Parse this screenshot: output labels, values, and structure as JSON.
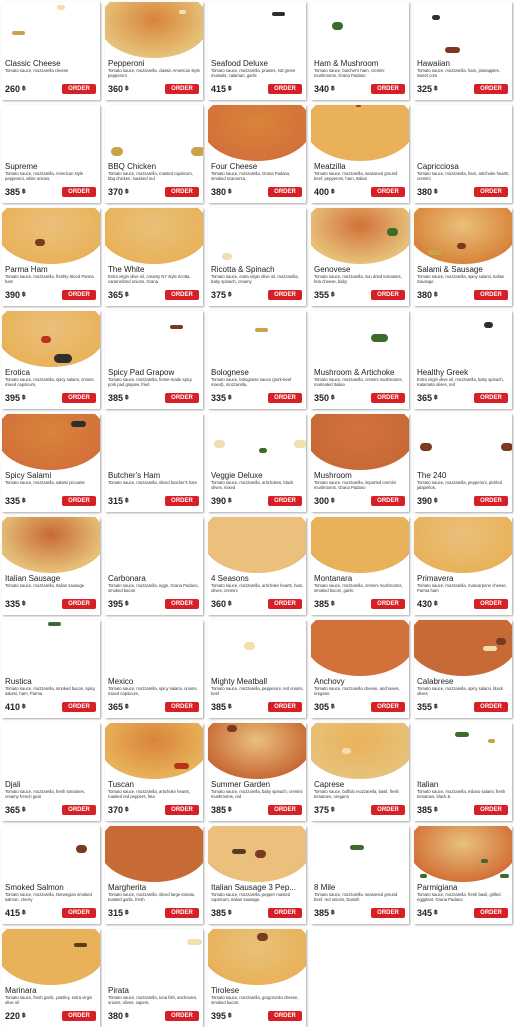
{
  "currency_symbol": "฿",
  "order_label": "ORDER",
  "colors": {
    "order_button": "#d71f26",
    "crust": "#d98c3a"
  },
  "menu": [
    {
      "name": "Classic Cheese",
      "desc": "Tomato sauce, mozzarella cheese",
      "price": "260",
      "image": "pizza-cheese"
    },
    {
      "name": "Pepperoni",
      "desc": "Tomato sauce, mozzarella, classic American style pepperoni",
      "price": "360",
      "image": "pizza-pepperoni"
    },
    {
      "name": "Seafood Deluxe",
      "desc": "Tomato sauce, mozzarella, prawns, NZ green mussels, calamari, garlic",
      "price": "415",
      "image": "pizza-seafood"
    },
    {
      "name": "Ham & Mushroom",
      "desc": "Tomato sauce, butcher's ham, cremini mushrooms, Grana Padano",
      "price": "340",
      "image": "pizza-ham-mushroom"
    },
    {
      "name": "Hawaiian",
      "desc": "Tomato sauce, mozzarella, ham, pineapples, sweet corn",
      "price": "325",
      "image": "pizza-hawaiian"
    },
    {
      "name": "Supreme",
      "desc": "Tomato sauce, mozzarella, American style pepperoni, white onions,",
      "price": "385",
      "image": "pizza-supreme"
    },
    {
      "name": "BBQ Chicken",
      "desc": "Tomato sauce, mozzarella, roasted capsicum, bbq chicken, sautéed red",
      "price": "370",
      "image": "pizza-bbq"
    },
    {
      "name": "Four Cheese",
      "desc": "Tomato sauce, mozzarella, Grana Padano, smoked scamorza,",
      "price": "380",
      "image": "pizza-four-cheese"
    },
    {
      "name": "Meatzilla",
      "desc": "Tomato sauce, mozzarella, seasoned ground beef, pepperoni, ham, Italian",
      "price": "400",
      "image": "pizza-meatzilla"
    },
    {
      "name": "Capricciosa",
      "desc": "Tomato sauce, mozzarella, ham, artichoke hearts, cremini",
      "price": "380",
      "image": "pizza-capricciosa"
    },
    {
      "name": "Parma Ham",
      "desc": "Tomato sauce, mozzarella, freshly sliced Parma ham",
      "price": "390",
      "image": "pizza-parma"
    },
    {
      "name": "The White",
      "desc": "Extra virgin olive oil, creamy NY style ricotta, caramelized onions, Grana",
      "price": "365",
      "image": "pizza-white"
    },
    {
      "name": "Ricotta & Spinach",
      "desc": "Tomato sauce, extra virgin olive oil, mozzarella, baby spinach, creamy",
      "price": "375",
      "image": "pizza-ricotta"
    },
    {
      "name": "Genovese",
      "desc": "Tomato sauce, mozzarella, sun dried tomatoes, feta cheese, baby",
      "price": "355",
      "image": "pizza-genovese"
    },
    {
      "name": "Salami & Sausage",
      "desc": "Tomato sauce, mozzarella, spicy salami, Italian Sausage",
      "price": "380",
      "image": "pizza-salami-sausage"
    },
    {
      "name": "Erotica",
      "desc": "Tomato sauce, mozzarella, spicy salami, onions, mixed capsicum,",
      "price": "395",
      "image": "pizza-erotica"
    },
    {
      "name": "Spicy Pad Grapow",
      "desc": "Tomato sauce, mozzarella, home-made spicy pork pad grapow, fried",
      "price": "385",
      "image": "pizza-grapow"
    },
    {
      "name": "Bolognese",
      "desc": "Tomato sauce, bolognese sauce (pork-beef mixed), mozzarella,",
      "price": "335",
      "image": "pizza-bolognese"
    },
    {
      "name": "Mushroom & Artichoke",
      "desc": "Tomato sauce, mozzarella, cremini mushrooms, marinated Italian",
      "price": "350",
      "image": "pizza-mushroom-artichoke"
    },
    {
      "name": "Healthy Greek",
      "desc": "Extra virgin olive oil, mozzarella, baby spinach, Kalamata olives, red",
      "price": "365",
      "image": "pizza-greek"
    },
    {
      "name": "Spicy Salami",
      "desc": "Tomato sauce, mozzarella, salami piccante",
      "price": "335",
      "image": "pizza-spicy-salami"
    },
    {
      "name": "Butcher's Ham",
      "desc": "Tomato sauce, mozzarella, sliced butcher's ham",
      "price": "315",
      "image": "pizza-butchers-ham"
    },
    {
      "name": "Veggie Deluxe",
      "desc": "Tomato sauce, mozzarella, artichokes, black olives, mixed",
      "price": "390",
      "image": "pizza-veggie"
    },
    {
      "name": "Mushroom",
      "desc": "Tomato sauce, mozzarella, imported cremini mushrooms, Grana Padano",
      "price": "300",
      "image": "pizza-mushroom"
    },
    {
      "name": "The 240",
      "desc": "Tomato sauce, mozzarella, pepperoni, pickled jalapeños,",
      "price": "390",
      "image": "pizza-240"
    },
    {
      "name": "Italian Sausage",
      "desc": "Tomato sauce, mozzarella, Italian sausage",
      "price": "335",
      "image": "pizza-italian-sausage"
    },
    {
      "name": "Carbonara",
      "desc": "Tomato sauce, mozzarella, eggs, Grana Padano, smoked bacon",
      "price": "395",
      "image": "pizza-carbonara"
    },
    {
      "name": "4 Seasons",
      "desc": "Tomato sauce, mozzarella, artichoke hearts, ham, olives, cremini",
      "price": "360",
      "image": "pizza-4-seasons"
    },
    {
      "name": "Montanara",
      "desc": "Tomato sauce, mozzarella, cremini mushrooms, smoked bacon, garlic",
      "price": "385",
      "image": "pizza-montanara"
    },
    {
      "name": "Primavera",
      "desc": "Tomato sauce, mozzarella, mascarpone cheese, Parma ham",
      "price": "430",
      "image": "pizza-primavera"
    },
    {
      "name": "Rustica",
      "desc": "Tomato sauce, mozzarella, smoked bacon, spicy salami, ham, Parma",
      "price": "410",
      "image": "pizza-rustica"
    },
    {
      "name": "Mexico",
      "desc": "Tomato sauce, mozzarella, spicy salami, onions, mixed capsicum,",
      "price": "365",
      "image": "pizza-mexico"
    },
    {
      "name": "Mighty Meatball",
      "desc": "Tomato sauce, mozzarella, pepperoni, red onions, beef",
      "price": "385",
      "image": "pizza-meatball"
    },
    {
      "name": "Anchovy",
      "desc": "Tomato sauce, mozzarella cheese, anchovies, oregano",
      "price": "305",
      "image": "pizza-anchovy"
    },
    {
      "name": "Calabrese",
      "desc": "Tomato sauce, mozzarella, spicy salami, black olives",
      "price": "355",
      "image": "pizza-calabrese"
    },
    {
      "name": "Djali",
      "desc": "Tomato sauce, mozzarella, fresh tomatoes, creamy french goat",
      "price": "365",
      "image": "pizza-djali"
    },
    {
      "name": "Tuscan",
      "desc": "Tomato sauce, mozzarella, artichoke hearts, roasted red peppers, feta",
      "price": "370",
      "image": "pizza-tuscan"
    },
    {
      "name": "Summer Garden",
      "desc": "Tomato sauce, mozzarella, baby spinach, cremini mushrooms, red",
      "price": "385",
      "image": "pizza-summer-garden"
    },
    {
      "name": "Caprese",
      "desc": "Tomato sauce, buffalo mozzarella, basil, fresh tomatoes, oregano",
      "price": "375",
      "image": "pizza-caprese"
    },
    {
      "name": "Italian",
      "desc": "Tomato sauce, mozzarella, milano salami, fresh tomatoes, black &",
      "price": "385",
      "image": "pizza-italian"
    },
    {
      "name": "Smoked Salmon",
      "desc": "Tomato sauce, mozzarella, Norwegian smoked salmon, cherry",
      "price": "415",
      "image": "pizza-salmon"
    },
    {
      "name": "Margherita",
      "desc": "Tomato sauce, mozzarella, sliced large tomato, toasted garlic, fresh",
      "price": "315",
      "image": "pizza-margherita"
    },
    {
      "name": "Italian Sausage 3 Pep...",
      "desc": "Tomato sauce, mozzarella, pepper roasted capsicum, Italian sausage,",
      "price": "385",
      "image": "pizza-sausage-3-pep"
    },
    {
      "name": "8 Mile",
      "desc": "Tomato sauce, mozzarella, seasoned ground beef, red onions, Danish",
      "price": "385",
      "image": "pizza-8-mile"
    },
    {
      "name": "Parmigiana",
      "desc": "Tomato sauce, mozzarella, fresh basil, grilled eggplant, Grana Padano",
      "price": "345",
      "image": "pizza-parmigiana"
    },
    {
      "name": "Marinara",
      "desc": "Tomato sauce, fresh garlic, parsley, extra virgin olive oil",
      "price": "220",
      "image": "pizza-marinara"
    },
    {
      "name": "Pirata",
      "desc": "Tomato sauce, mozzarella, tuna fish, anchovies, onions, olives, capers,",
      "price": "380",
      "image": "pizza-pirata"
    },
    {
      "name": "Tirolese",
      "desc": "Tomato sauce, mozzarella, gorgonzola cheese, smoked bacon,",
      "price": "395",
      "image": "pizza-tirolese"
    }
  ]
}
